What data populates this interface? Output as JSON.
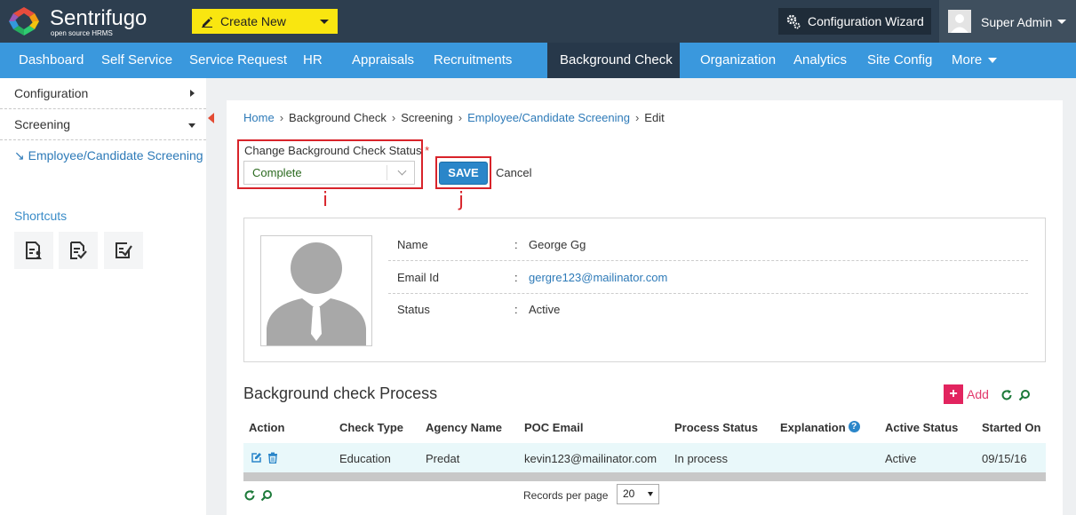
{
  "app": {
    "brand_name": "Sentrifugo",
    "brand_tagline": "open source HRMS",
    "create_new_label": "Create New",
    "config_wizard_label": "Configuration Wizard",
    "user_name": "Super Admin"
  },
  "nav": {
    "items": [
      "Dashboard",
      "Self Service",
      "Service Request",
      "HR",
      "Appraisals",
      "Recruitments",
      "Background Check",
      "Organization",
      "Analytics",
      "Site Config",
      "More"
    ],
    "active": "Background Check"
  },
  "sidebar": {
    "configuration": "Configuration",
    "screening": "Screening",
    "sub_item": "Employee/Candidate Screening",
    "sub_item_arrow": "↘",
    "shortcuts_label": "Shortcuts"
  },
  "breadcrumb": {
    "items": [
      "Home",
      "Background Check",
      "Screening",
      "Employee/Candidate Screening",
      "Edit"
    ],
    "separator": "›"
  },
  "status_form": {
    "label": "Change Background Check Status",
    "required_mark": "*",
    "selected_value": "Complete",
    "save_label": "SAVE",
    "cancel_label": "Cancel"
  },
  "callouts": {
    "i": "i",
    "j": "j"
  },
  "profile": {
    "name_key": "Name",
    "name_value": "George Gg",
    "email_key": "Email Id",
    "email_value": "gergre123@mailinator.com",
    "status_key": "Status",
    "status_value": "Active",
    "colon": ":"
  },
  "process": {
    "title": "Background check Process",
    "add_label": "Add",
    "columns": [
      "Action",
      "Check Type",
      "Agency Name",
      "POC Email",
      "Process Status",
      "Explanation",
      "Active Status",
      "Started On"
    ],
    "explanation_help": "?",
    "rows": [
      {
        "check_type": "Education",
        "agency_name": "Predat",
        "poc_email": "kevin123@mailinator.com",
        "process_status": "In process",
        "explanation": "",
        "active_status": "Active",
        "started_on": "09/15/16"
      }
    ],
    "records_per_page_label": "Records per page",
    "records_per_page_value": "20"
  },
  "colors": {
    "topbar": "#2d3e4f",
    "nav": "#3a98dd",
    "nav_active": "#27384a",
    "create_new": "#f9e610",
    "accent_link": "#2d7ab8",
    "callout_red": "#d8232a",
    "add_pink": "#e2245f"
  },
  "icons": {
    "create_new": "pencil-icon",
    "config_wizard": "gears-icon",
    "edit": "edit-icon",
    "delete": "trash-icon",
    "refresh": "refresh-icon",
    "search": "search-icon"
  }
}
